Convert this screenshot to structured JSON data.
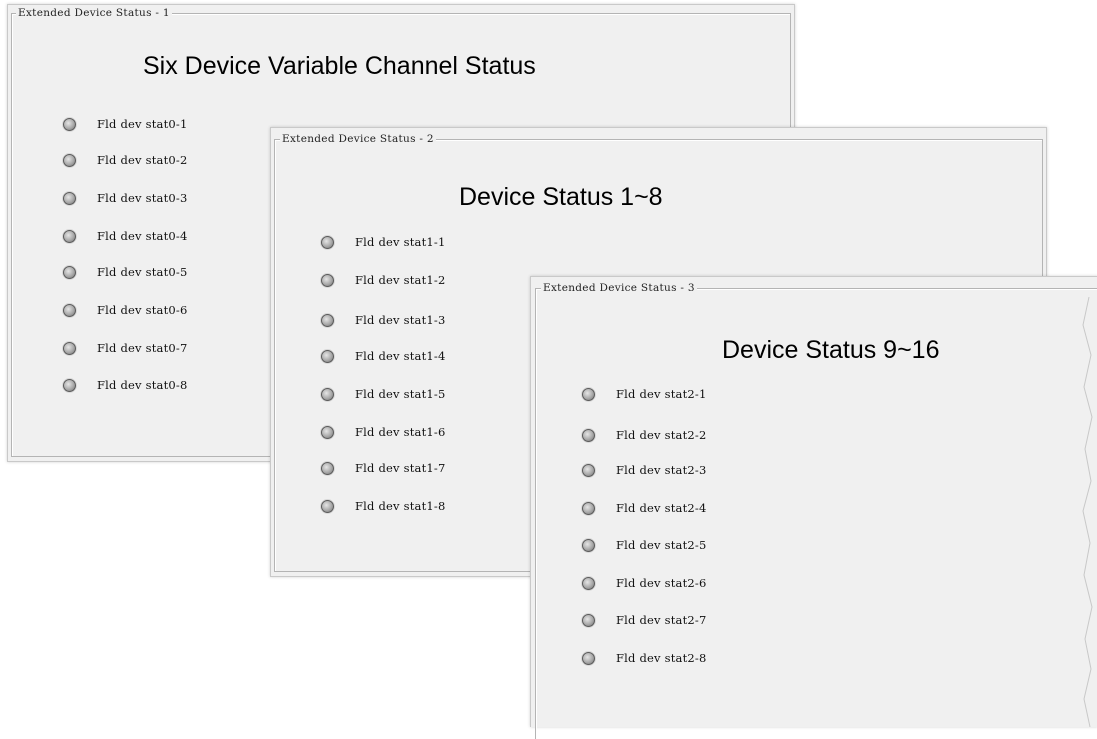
{
  "panels": [
    {
      "group_title": "Extended Device Status - 1",
      "heading": "Six Device Variable Channel Status",
      "items": [
        "Fld dev stat0-1",
        "Fld dev stat0-2",
        "Fld dev stat0-3",
        "Fld dev stat0-4",
        "Fld dev stat0-5",
        "Fld dev stat0-6",
        "Fld dev stat0-7",
        "Fld dev stat0-8"
      ]
    },
    {
      "group_title": "Extended Device Status - 2",
      "heading": "Device Status 1~8",
      "items": [
        "Fld dev stat1-1",
        "Fld dev stat1-2",
        "Fld dev stat1-3",
        "Fld dev stat1-4",
        "Fld dev stat1-5",
        "Fld dev stat1-6",
        "Fld dev stat1-7",
        "Fld dev stat1-8"
      ]
    },
    {
      "group_title": "Extended Device Status - 3",
      "heading": "Device Status 9~16",
      "items": [
        "Fld dev stat2-1",
        "Fld dev stat2-2",
        "Fld dev stat2-3",
        "Fld dev stat2-4",
        "Fld dev stat2-5",
        "Fld dev stat2-6",
        "Fld dev stat2-7",
        "Fld dev stat2-8"
      ]
    }
  ],
  "led_state": "off",
  "colors": {
    "panel_bg": "#f0f0f0",
    "led_off": "#a9a9a9"
  }
}
